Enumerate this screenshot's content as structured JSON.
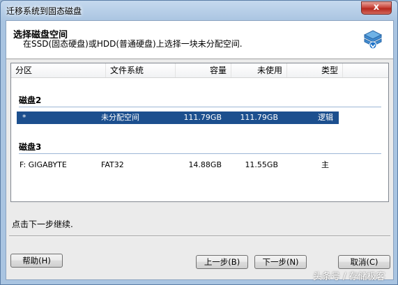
{
  "window": {
    "title": "迁移系统到固态磁盘",
    "close_label": "x"
  },
  "header": {
    "title": "选择磁盘空间",
    "subtitle": "在SSD(固态硬盘)或HDD(普通硬盘)上选择一块未分配空间.",
    "icon": "disk-stack-icon"
  },
  "table": {
    "columns": [
      "分区",
      "文件系统",
      "容量",
      "未使用",
      "类型"
    ],
    "groups": [
      {
        "label": "磁盘2",
        "rows": [
          {
            "partition": "*",
            "filesystem": "未分配空间",
            "capacity": "111.79GB",
            "unused": "111.79GB",
            "type": "逻辑",
            "selected": true
          }
        ]
      },
      {
        "label": "磁盘3",
        "rows": [
          {
            "partition": "F:  GIGABYTE",
            "filesystem": "FAT32",
            "capacity": "14.88GB",
            "unused": "11.55GB",
            "type": "主",
            "selected": false
          }
        ]
      }
    ]
  },
  "status": {
    "text": "点击下一步继续."
  },
  "buttons": {
    "help": "帮助(H)",
    "back": "上一步(B)",
    "next": "下一步(N)",
    "cancel": "取消(C)"
  },
  "watermark": {
    "text": "头条号 / 存储极客"
  },
  "colors": {
    "selection": "#1c4f8e",
    "close": "#c9463c",
    "frame": "#a9c4e1"
  }
}
